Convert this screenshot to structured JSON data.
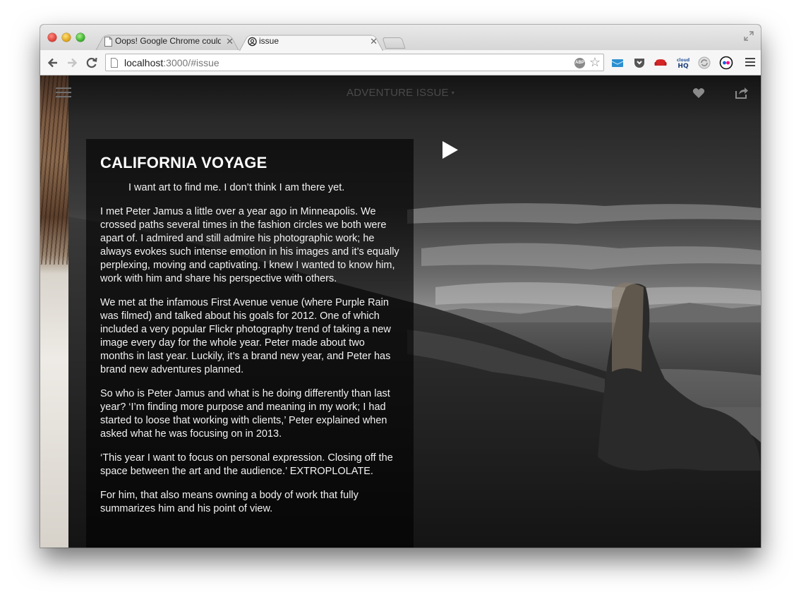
{
  "browser": {
    "tabs": [
      {
        "label": "Oops! Google Chrome could",
        "icon": "page-icon"
      },
      {
        "label": "issue",
        "icon": "issue-favicon"
      }
    ],
    "url_host": "localhost",
    "url_rest": ":3000/#issue",
    "abp_label": "ABP"
  },
  "app": {
    "issue_title": "ADVENTURE ISSUE",
    "caret": "▾"
  },
  "article": {
    "title": "CALIFORNIA VOYAGE",
    "quote": "I want art to find me. I don’t think I am there yet.",
    "paragraphs": [
      "I met Peter Jamus a little over a year ago in Minneapolis. We crossed paths several times in the fashion circles we both were apart of. I admired and still admire his photographic work; he always evokes such intense emotion in his images and it’s equally perplexing, moving and captivating. I knew I wanted to know him, work with him and share his perspective with others.",
      "We met at the infamous First Avenue venue (where Purple Rain was filmed) and talked about his goals for 2012. One of which included a very popular Flickr photography trend of taking a new image every day for the whole year. Peter made about two months in last year. Luckily, it’s a brand new year, and Peter has brand new adventures planned.",
      "So who is Peter Jamus and what is he doing differently than last year? ‘I’m finding more purpose and meaning in my work; I had started to loose that working with clients,’ Peter explained when asked what he was focusing on in 2013.",
      "‘This year I want to focus on personal expression. Closing off the space between the art and the audience.’ EXTROPLOLATE.",
      "For him, that also means owning a body of work that fully summarizes him and his point of view."
    ]
  }
}
